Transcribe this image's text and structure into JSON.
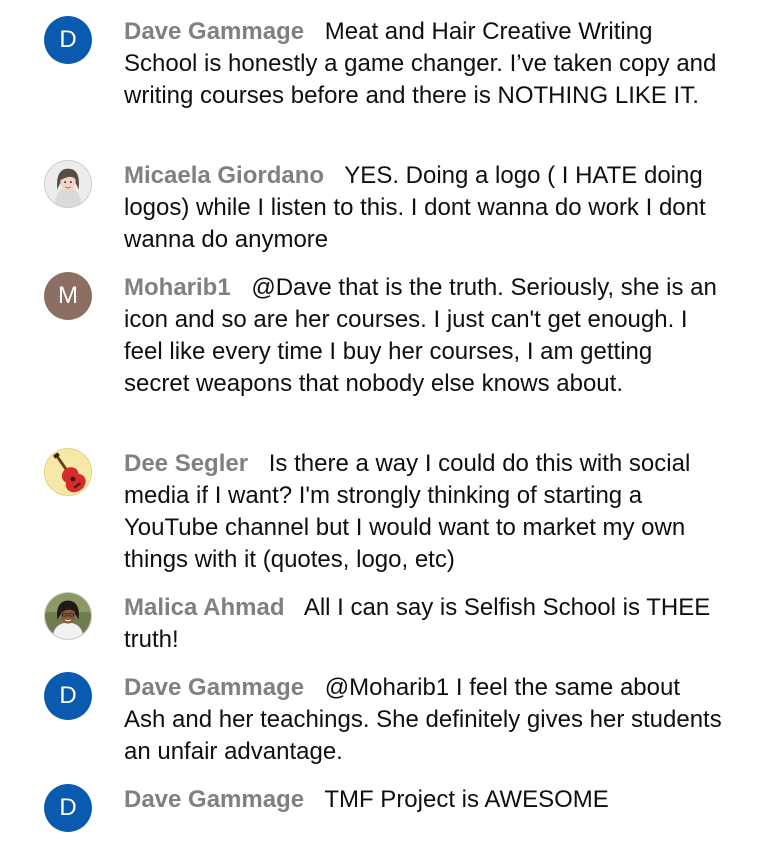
{
  "chat": {
    "messages": [
      {
        "author": "Dave Gammage",
        "avatar_letter": "D",
        "avatar_color": "#0a5bb0",
        "text": "Meat and Hair Creative Writing School is honestly a game changer. I’ve taken copy and writing courses before and there is NOTHING LIKE IT."
      },
      {
        "author": "Micaela Giordano",
        "avatar_icon": "woman-portrait-avatar-icon",
        "text": "YES. Doing a logo ( I HATE doing logos) while I listen to this. I dont wanna do work I dont wanna do anymore"
      },
      {
        "author": "Moharib1",
        "avatar_letter": "M",
        "avatar_color": "#8d6e63",
        "text": "@Dave that is the truth. Seriously, she is an icon and so are her courses. I just can't get enough. I feel like every time I buy her courses, I am getting secret weapons that nobody else knows about."
      },
      {
        "author": "Dee Segler",
        "avatar_icon": "guitar-avatar-icon",
        "text": "Is there a way I could do this with social media if I want? I'm strongly thinking of starting a YouTube channel but I would want to market my own things with it (quotes, logo, etc)"
      },
      {
        "author": "Malica Ahmad",
        "avatar_icon": "portrait-photo-avatar-icon",
        "text": "All I can say is Selfish School is THEE truth!"
      },
      {
        "author": "Dave Gammage",
        "avatar_letter": "D",
        "avatar_color": "#0a5bb0",
        "text": "@Moharib1 I feel the same about Ash and her teachings. She definitely gives her students an unfair advantage."
      },
      {
        "author": "Dave Gammage",
        "avatar_letter": "D",
        "avatar_color": "#0a5bb0",
        "text": "TMF Project is AWESOME"
      }
    ]
  }
}
